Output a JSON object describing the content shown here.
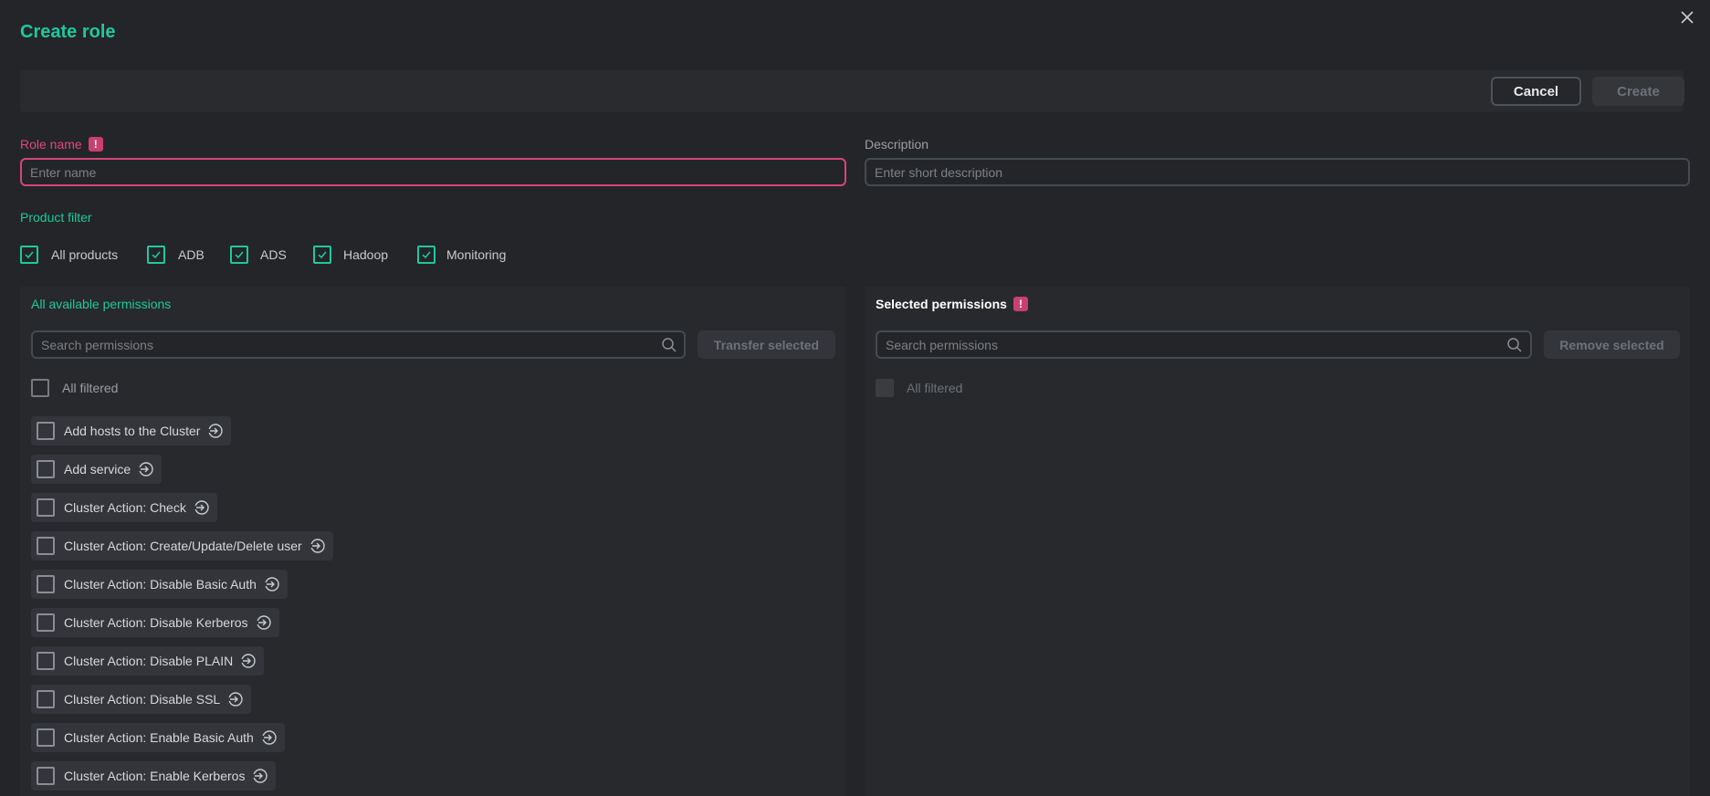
{
  "dialog": {
    "title": "Create role"
  },
  "toolbar": {
    "cancel_label": "Cancel",
    "create_label": "Create"
  },
  "role_name": {
    "label": "Role name",
    "badge": "!",
    "placeholder": "Enter name",
    "value": ""
  },
  "description": {
    "label": "Description",
    "placeholder": "Enter short description",
    "value": ""
  },
  "product_filter": {
    "label": "Product filter",
    "options": [
      {
        "label": "All products",
        "checked": true
      },
      {
        "label": "ADB",
        "checked": true
      },
      {
        "label": "ADS",
        "checked": true
      },
      {
        "label": "Hadoop",
        "checked": true
      },
      {
        "label": "Monitoring",
        "checked": true
      }
    ]
  },
  "available": {
    "title": "All available permissions",
    "search_placeholder": "Search permissions",
    "transfer_label": "Transfer selected",
    "all_filtered_label": "All filtered",
    "items": [
      "Add hosts to the Cluster",
      "Add service",
      "Cluster Action: Check",
      "Cluster Action: Create/Update/Delete user",
      "Cluster Action: Disable Basic Auth",
      "Cluster Action: Disable Kerberos",
      "Cluster Action: Disable PLAIN",
      "Cluster Action: Disable SSL",
      "Cluster Action: Enable Basic Auth",
      "Cluster Action: Enable Kerberos"
    ]
  },
  "selected": {
    "title": "Selected permissions",
    "badge": "!",
    "search_placeholder": "Search permissions",
    "remove_label": "Remove selected",
    "all_filtered_label": "All filtered"
  },
  "colors": {
    "accent": "#1ec8a0",
    "error": "#d5467a",
    "background": "#242528"
  },
  "icons": {
    "close": "close-icon",
    "check": "check-icon",
    "search": "search-icon",
    "transfer": "transfer-arrow-icon"
  }
}
